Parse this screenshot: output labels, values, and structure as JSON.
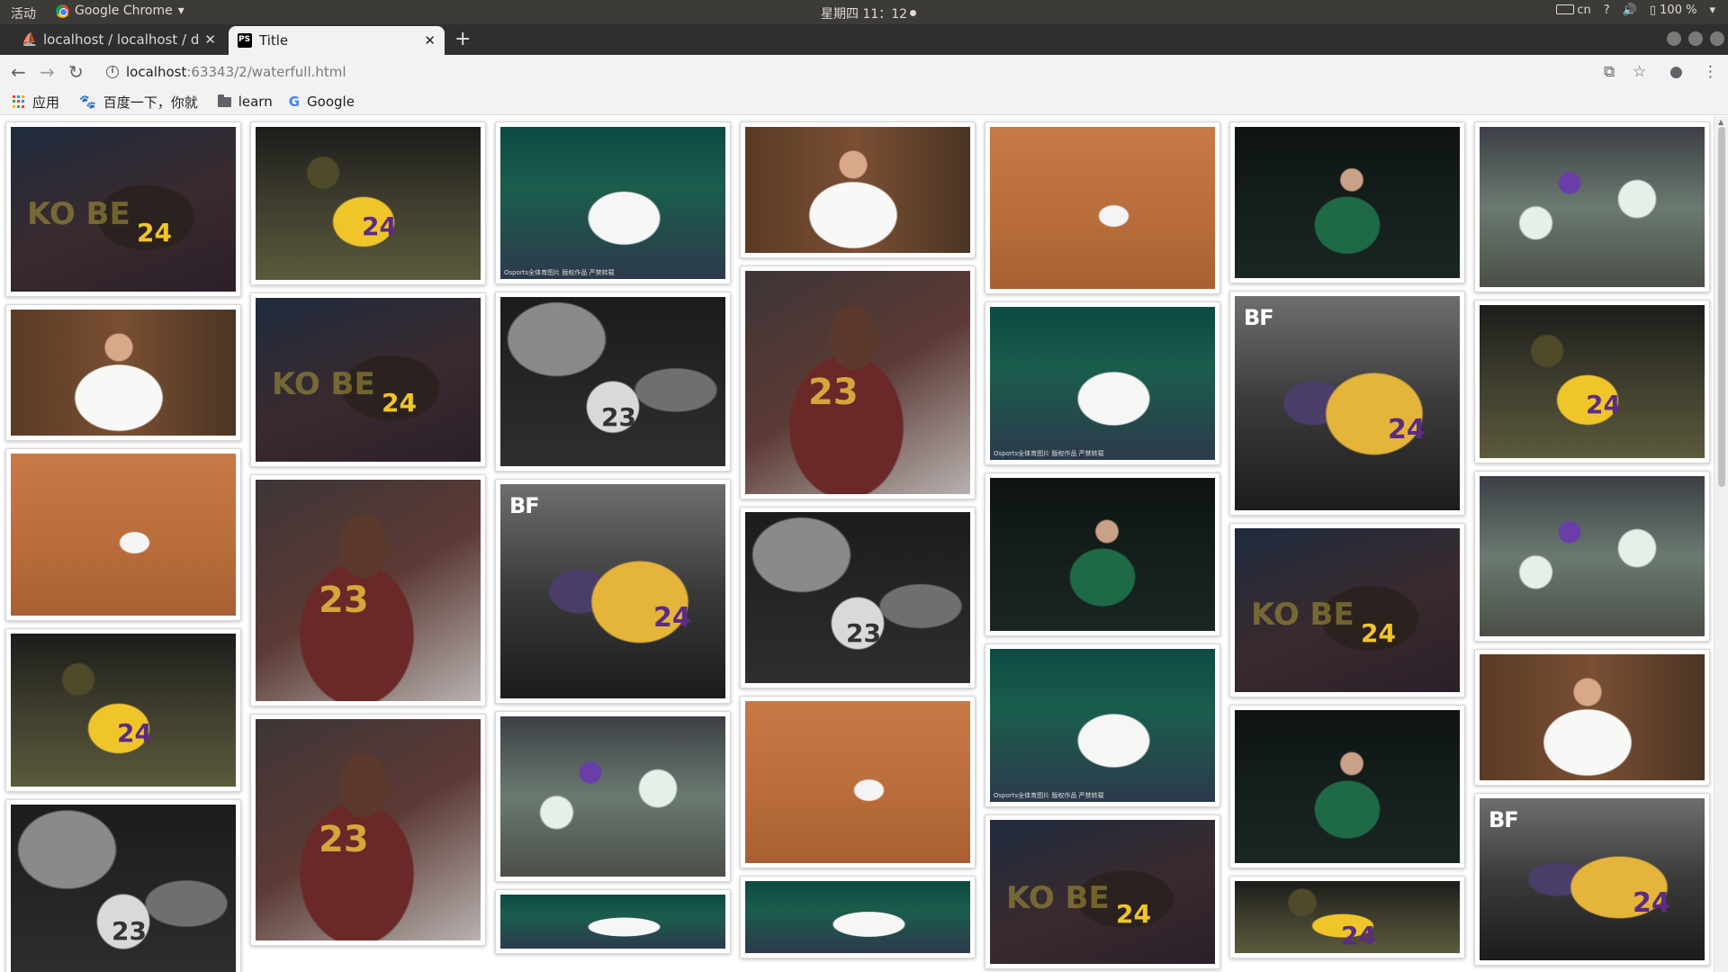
{
  "system_bar": {
    "activities": "活动",
    "app_name": "Google Chrome",
    "clock": "星期四 11：12",
    "input_method": "cn",
    "help": "?",
    "battery": "100 %"
  },
  "tabs": [
    {
      "title": "localhost / localhost / dat",
      "active": false
    },
    {
      "title": "Title",
      "active": true
    }
  ],
  "address_bar": {
    "host": "localhost",
    "path": ":63343/2/waterfull.html"
  },
  "bookmarks": [
    {
      "label": "应用",
      "icon": "apps-icon"
    },
    {
      "label": "百度一下，你就",
      "icon": "baidu-paw-icon"
    },
    {
      "label": "learn",
      "icon": "folder-icon"
    },
    {
      "label": "Google",
      "icon": "google-icon"
    }
  ],
  "images": [
    {
      "theme": "kobe-back",
      "text": "24",
      "overlay": "KO BE"
    },
    {
      "theme": "djoko-warm",
      "text": ""
    },
    {
      "theme": "clay",
      "text": ""
    },
    {
      "theme": "kobe-yellow",
      "text": "24"
    },
    {
      "theme": "lebron-bw",
      "text": "23"
    },
    {
      "theme": "kobe-yellow",
      "text": "24"
    },
    {
      "theme": "kobe-back",
      "text": "24",
      "overlay": "KO BE"
    },
    {
      "theme": "lebron-red",
      "text": "23"
    },
    {
      "theme": "lebron-red",
      "text": "23"
    },
    {
      "theme": "djoko-white",
      "text": "",
      "caption": "Osports全体育图片 版权作品 严禁转载"
    },
    {
      "theme": "lebron-bw",
      "text": "23"
    },
    {
      "theme": "kobe-lakers",
      "text": "24",
      "brand": "BF"
    },
    {
      "theme": "celtics",
      "text": ""
    },
    {
      "theme": "djoko-white",
      "text": ""
    },
    {
      "theme": "djoko-warm",
      "text": ""
    },
    {
      "theme": "lebron-red",
      "text": "23"
    },
    {
      "theme": "lebron-bw",
      "text": "23"
    },
    {
      "theme": "clay",
      "text": ""
    },
    {
      "theme": "djoko-white",
      "text": ""
    },
    {
      "theme": "clay",
      "text": ""
    },
    {
      "theme": "djoko-white",
      "text": "",
      "caption": "Osports全体育图片 版权作品 严禁转载"
    },
    {
      "theme": "djoko-green",
      "text": ""
    },
    {
      "theme": "djoko-white",
      "text": "",
      "caption": "Osports全体育图片 版权作品 严禁转载"
    },
    {
      "theme": "kobe-back",
      "text": "24",
      "overlay": "KO BE"
    },
    {
      "theme": "djoko-green",
      "text": ""
    },
    {
      "theme": "kobe-lakers",
      "text": "24",
      "brand": "BF"
    },
    {
      "theme": "kobe-back",
      "text": "24",
      "overlay": "KO BE"
    },
    {
      "theme": "djoko-green",
      "text": ""
    },
    {
      "theme": "kobe-yellow",
      "text": "24"
    },
    {
      "theme": "celtics",
      "text": ""
    },
    {
      "theme": "kobe-yellow",
      "text": "24"
    },
    {
      "theme": "celtics",
      "text": ""
    },
    {
      "theme": "djoko-warm",
      "text": ""
    },
    {
      "theme": "kobe-lakers",
      "text": "24",
      "brand": "BF"
    }
  ]
}
